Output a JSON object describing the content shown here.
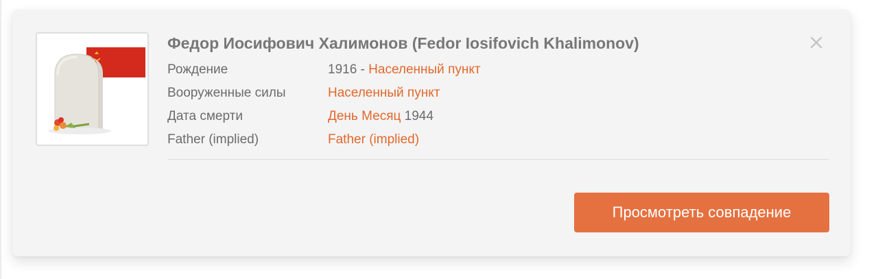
{
  "record": {
    "title": "Федор Иосифович Халимонов (Fedor Iosifovich Khalimonov)",
    "rows": [
      {
        "label": "Рождение",
        "prefix": "1916 - ",
        "link": "Населенный пункт",
        "suffix": ""
      },
      {
        "label": "Вооруженные силы",
        "prefix": "",
        "link": "Населенный пункт",
        "suffix": ""
      },
      {
        "label": "Дата смерти",
        "prefix": "",
        "link": "День Месяц",
        "suffix": " 1944"
      },
      {
        "label": "Father (implied)",
        "prefix": "",
        "link": "Father (implied)",
        "suffix": ""
      }
    ]
  },
  "actions": {
    "view_match_label": "Просмотреть совпадение"
  },
  "icons": {
    "close": "close-icon",
    "thumbnail": "gravestone-with-soviet-flag-icon"
  },
  "colors": {
    "accent": "#e2682d",
    "button": "#e57140",
    "card_background": "#f4f4f4",
    "flag_red": "#d42a1e"
  }
}
